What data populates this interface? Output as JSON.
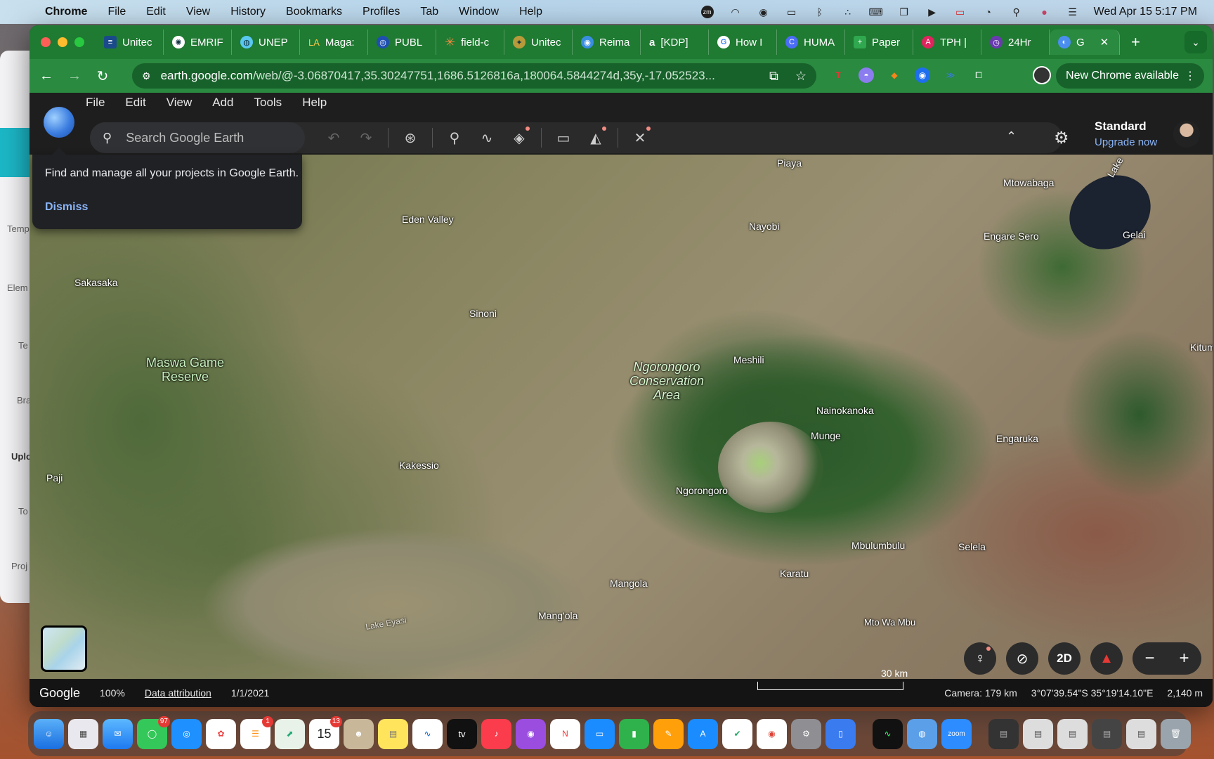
{
  "menubar": {
    "app": "Chrome",
    "items": [
      "File",
      "Edit",
      "View",
      "History",
      "Bookmarks",
      "Profiles",
      "Tab",
      "Window",
      "Help"
    ],
    "datetime": "Wed Apr 15  5:17 PM",
    "zoom_badge": "zm"
  },
  "background_window": {
    "labels": [
      "Temp",
      "Elem",
      "Te",
      "Bra",
      "Uplo",
      "To",
      "Proj"
    ]
  },
  "browser": {
    "tabs": [
      {
        "label": "Unitec",
        "favicon": "un-icon"
      },
      {
        "label": "EMRIF",
        "favicon": "emrif-icon"
      },
      {
        "label": "UNEP",
        "favicon": "unep-icon"
      },
      {
        "label": "Maga:",
        "favicon": "la-icon"
      },
      {
        "label": "PUBL",
        "favicon": "publ-icon"
      },
      {
        "label": "field-c",
        "favicon": "asterisk-icon"
      },
      {
        "label": "Unitec",
        "favicon": "unitec-icon"
      },
      {
        "label": "Reima",
        "favicon": "globe-icon"
      },
      {
        "label": "[KDP]",
        "favicon": "amazon-icon"
      },
      {
        "label": "How I",
        "favicon": "google-icon"
      },
      {
        "label": "HUMA",
        "favicon": "c-icon"
      },
      {
        "label": "Paper",
        "favicon": "plus-icon"
      },
      {
        "label": "TPH |",
        "favicon": "tph-icon"
      },
      {
        "label": "24Hr",
        "favicon": "24hr-icon"
      },
      {
        "label": "G",
        "favicon": "earth-icon"
      }
    ],
    "url_host": "earth.google.com",
    "url_path": "/web/@-3.06870417,35.30247751,1686.5126816a,180064.5844274d,35y,-17.052523...",
    "new_chrome": "New Chrome available",
    "la_prefix": "LA"
  },
  "earth": {
    "menu": [
      "File",
      "Edit",
      "View",
      "Add",
      "Tools",
      "Help"
    ],
    "search_placeholder": "Search Google Earth",
    "plan": "Standard",
    "upgrade": "Upgrade now",
    "callout": {
      "message": "Find and manage all your projects in Google Earth.",
      "dismiss": "Dismiss"
    },
    "labels": {
      "piaya": "Piaya",
      "mtowabaga": "Mtowabaga",
      "lake": "Lake",
      "eden_valley": "Eden Valley",
      "nayobi": "Nayobi",
      "engare_sero": "Engare Sero",
      "gelai": "Gelai",
      "sakasaka": "Sakasaka",
      "sinoni": "Sinoni",
      "maswa": "Maswa Game\nReserve",
      "meshili": "Meshili",
      "ncaa": "Ngorongoro\nConservation\nArea",
      "kitum": "Kitum",
      "nainokanoka": "Nainokanoka",
      "munge": "Munge",
      "engaruka": "Engaruka",
      "kakessio": "Kakessio",
      "paji": "Paji",
      "ngorongoro": "Ngorongoro",
      "mbulumbulu": "Mbulumbulu",
      "selela": "Selela",
      "karatu": "Karatu",
      "mangola": "Mangola",
      "mangola2": "Mang'ola",
      "mto_wa_mbu": "Mto Wa Mbu",
      "lake_eyasi": "Lake Eyasi"
    },
    "controls": {
      "view_2d": "2D"
    },
    "status": {
      "brand": "Google",
      "zoom": "100%",
      "attribution": "Data attribution",
      "date": "1/1/2021",
      "scale": "30 km",
      "camera": "Camera: 179 km",
      "coords": "3°07'39.54\"S 35°19'14.10\"E",
      "elevation": "2,140 m"
    }
  },
  "dock": {
    "messages_badge": "97",
    "reminders_badge": "1",
    "calendar_badge": "13",
    "calendar_day": "15",
    "tv_label": "tv",
    "zoom_label": "zoom"
  }
}
